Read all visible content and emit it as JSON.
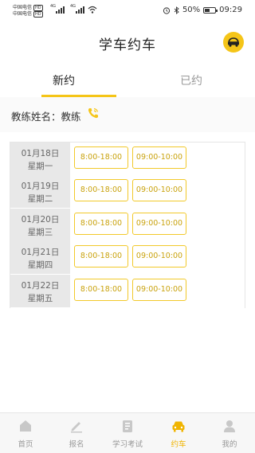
{
  "status_bar": {
    "carrier_1": "中国电信",
    "carrier_2": "中国电信",
    "hd_badge": "HD",
    "net_1": "4G",
    "net_2": "4G",
    "battery_percent": "50%",
    "battery_level": 0.5,
    "time": "09:29"
  },
  "header": {
    "title": "学车约车",
    "action_icon": "car-icon"
  },
  "tabs": [
    {
      "label": "新约",
      "active": true
    },
    {
      "label": "已约",
      "active": false
    }
  ],
  "coach": {
    "label": "教练姓名：教练",
    "phone_icon": "phone-icon"
  },
  "schedule": [
    {
      "date": "01月18日",
      "weekday": "星期一",
      "slots": [
        "8:00-18:00",
        "09:00-10:00"
      ]
    },
    {
      "date": "01月19日",
      "weekday": "星期二",
      "slots": [
        "8:00-18:00",
        "09:00-10:00"
      ]
    },
    {
      "date": "01月20日",
      "weekday": "星期三",
      "slots": [
        "8:00-18:00",
        "09:00-10:00"
      ]
    },
    {
      "date": "01月21日",
      "weekday": "星期四",
      "slots": [
        "8:00-18:00",
        "09:00-10:00"
      ]
    },
    {
      "date": "01月22日",
      "weekday": "星期五",
      "slots": [
        "8:00-18:00",
        "09:00-10:00"
      ]
    }
  ],
  "bottom_nav": [
    {
      "label": "首页",
      "icon": "home-icon",
      "active": false
    },
    {
      "label": "报名",
      "icon": "pen-icon",
      "active": false
    },
    {
      "label": "学习考试",
      "icon": "book-icon",
      "active": false
    },
    {
      "label": "约车",
      "icon": "car-icon",
      "active": true
    },
    {
      "label": "我的",
      "icon": "user-icon",
      "active": false
    }
  ],
  "colors": {
    "accent": "#f5c518",
    "accent_text": "#f0b400",
    "date_cell_bg": "#e8e8e8",
    "inactive_icon": "#c8c8c8"
  }
}
